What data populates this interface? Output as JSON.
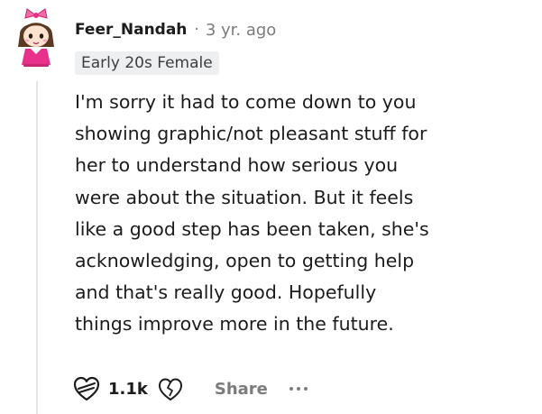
{
  "comment": {
    "author": "Feer_Nandah",
    "separator": "·",
    "timestamp": "3 yr. ago",
    "flair": "Early 20s Female",
    "body_lines": [
      "I'm sorry it had to come down to you",
      "showing graphic/not pleasant stuff for",
      "her to understand how serious you",
      "were about the situation. But it feels",
      "like a good step has been taken, she's",
      "acknowledging, open to getting help",
      "and that's really good. Hopefully",
      "things improve more in the future."
    ]
  },
  "actions": {
    "upvote_icon": "heart-upvote-icon",
    "vote_count": "1.1k",
    "downvote_icon": "heart-downvote-icon",
    "share_label": "Share",
    "more_icon": "more-options-icon"
  },
  "colors": {
    "text_primary": "#1c1c1c",
    "text_muted": "#7c7c7c",
    "flair_background": "#edeff1",
    "thread_line": "#e3e6e8",
    "avatar_accent": "#e8318a"
  }
}
